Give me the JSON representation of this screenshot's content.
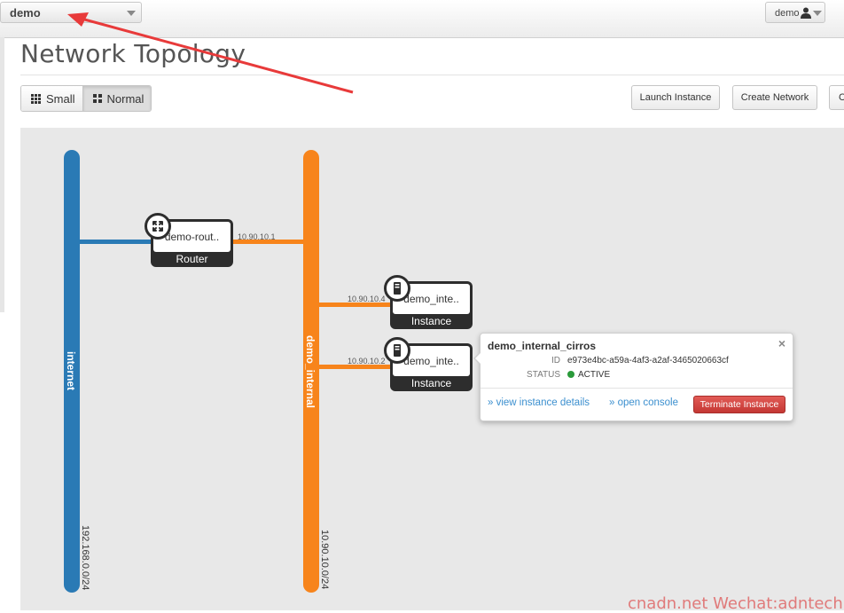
{
  "header": {
    "project_selector": "demo",
    "user_menu": "demo"
  },
  "page": {
    "title": "Network Topology"
  },
  "view_toggle": {
    "small": "Small",
    "normal": "Normal",
    "active": "Normal"
  },
  "actions": {
    "launch_instance": "Launch Instance",
    "create_network": "Create Network",
    "create_router": "C"
  },
  "topology": {
    "networks": [
      {
        "name": "internet",
        "cidr": "192.168.0.0/24",
        "color": "#2a7ab5"
      },
      {
        "name": "demo_internal",
        "cidr": "10.90.10.0/24",
        "color": "#f7841b"
      }
    ],
    "router": {
      "name": "demo-rout..",
      "type": "Router",
      "ip": "10.90.10.1"
    },
    "instances": [
      {
        "name": "demo_inte..",
        "type": "Instance",
        "ip": "10.90.10.4"
      },
      {
        "name": "demo_inte..",
        "type": "Instance",
        "ip": "10.90.10.2"
      }
    ]
  },
  "popup": {
    "title": "demo_internal_cirros",
    "id_label": "ID",
    "id_value": "e973e4bc-a59a-4af3-a2af-3465020663cf",
    "status_label": "STATUS",
    "status_value": "ACTIVE",
    "status_color": "#2a9a3a",
    "view_details": "» view instance details",
    "open_console": "» open console",
    "terminate": "Terminate Instance",
    "close": "×"
  },
  "watermark": "cnadn.net Wechat:adntech",
  "annotation_color": "#e83a3a"
}
